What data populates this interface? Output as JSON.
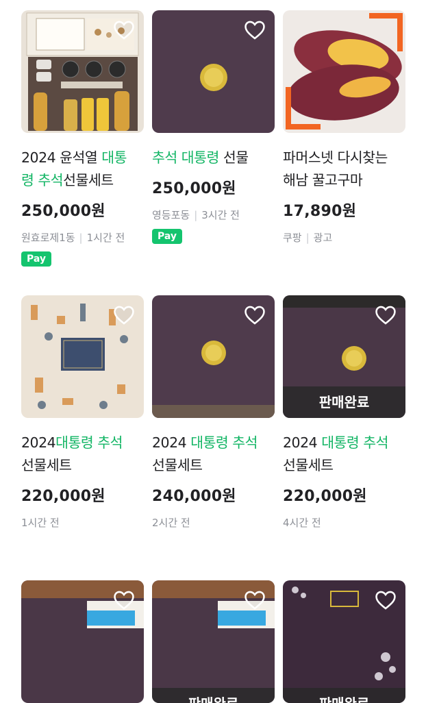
{
  "items": [
    {
      "title": [
        {
          "t": "2024 윤석열 "
        },
        {
          "t": "대통",
          "hl": true
        },
        {
          "t": "령 추석",
          "hl": true
        },
        {
          "t": "선물세트"
        }
      ],
      "price": "250,000원",
      "location": "원효로제1동",
      "time": "1시간 전",
      "pay": "Pay",
      "sold": ""
    },
    {
      "title": [
        {
          "t": "추석 대통령",
          "hl": true
        },
        {
          "t": " 선물"
        }
      ],
      "price": "250,000원",
      "location": "영등포동",
      "time": "3시간 전",
      "pay": "Pay",
      "sold": ""
    },
    {
      "title": [
        {
          "t": "파머스넷 다시찾는"
        },
        {
          "t": "해남 꿀고구마"
        }
      ],
      "price": "17,890원",
      "location": "쿠팡",
      "time": "광고",
      "pay": "",
      "sold": ""
    },
    {
      "title": [
        {
          "t": "2024"
        },
        {
          "t": "대통령 추석",
          "hl": true
        },
        {
          "t": "선물세트"
        }
      ],
      "price": "220,000원",
      "location": "",
      "time": "1시간 전",
      "pay": "",
      "sold": ""
    },
    {
      "title": [
        {
          "t": "2024 "
        },
        {
          "t": "대통령 추석",
          "hl": true
        },
        {
          "t": "선물세트"
        }
      ],
      "price": "240,000원",
      "location": "",
      "time": "2시간 전",
      "pay": "",
      "sold": ""
    },
    {
      "title": [
        {
          "t": "2024 "
        },
        {
          "t": "대통령 추석",
          "hl": true
        },
        {
          "t": "선물세트"
        }
      ],
      "price": "220,000원",
      "location": "",
      "time": "4시간 전",
      "pay": "",
      "sold": "판매완료"
    },
    {
      "title": [],
      "price": "",
      "location": "",
      "time": "",
      "pay": "",
      "sold": ""
    },
    {
      "title": [],
      "price": "",
      "location": "",
      "time": "",
      "pay": "",
      "sold": "판매완료"
    },
    {
      "title": [],
      "price": "",
      "location": "",
      "time": "",
      "pay": "",
      "sold": "판매완료"
    }
  ],
  "icons": {
    "like": "heart-outline-icon",
    "seal": "gold-seal-icon"
  },
  "colors": {
    "highlight": "#12b564",
    "pay_badge": "#14c46e",
    "meta_text": "#8c8f96",
    "sold_overlay": "#282828"
  }
}
